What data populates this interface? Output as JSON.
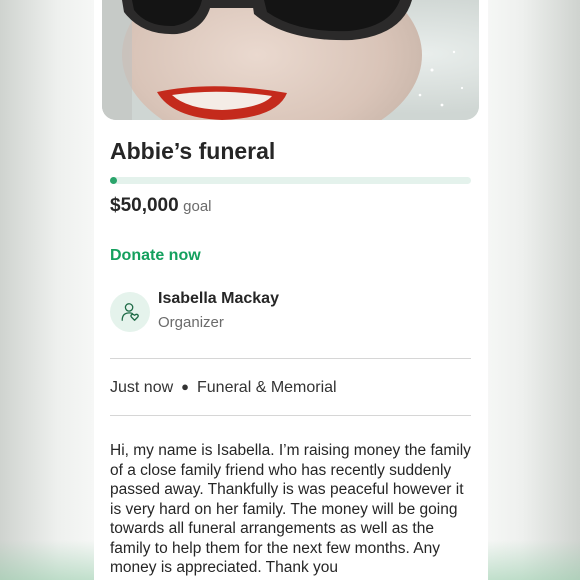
{
  "campaign": {
    "title": "Abbie’s funeral",
    "goal_amount": "$50,000",
    "goal_label": "goal",
    "progress_fraction": 0.01,
    "donate_label": "Donate now",
    "organizer": {
      "name": "Isabella Mackay",
      "role": "Organizer",
      "avatar_icon": "organizer-heart-icon"
    },
    "meta": {
      "time": "Just now",
      "separator": "●",
      "category": "Funeral & Memorial"
    },
    "story": "Hi, my name is Isabella. I’m raising money the family of a close family friend who has recently suddenly passed away. Thankfully is was peaceful however it is very hard on her family. The money will be going towards all funeral arrangements as well as the family to help them for the next few months. Any money is appreciated. Thank you"
  },
  "colors": {
    "accent_green": "#14a05e",
    "progress_fill": "#2aa46b",
    "progress_track": "#e4f2ec",
    "avatar_bg": "#e5f3ec"
  }
}
